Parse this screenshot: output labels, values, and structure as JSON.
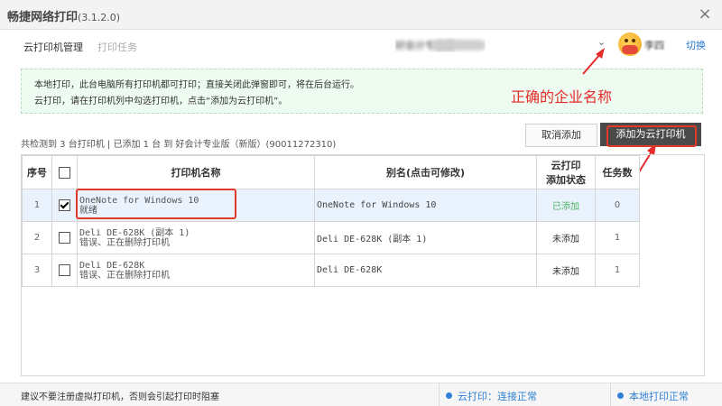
{
  "window": {
    "title": "畅捷网络打印",
    "version": "(3.1.2.0)",
    "close_glyph": "×"
  },
  "nav": {
    "manage": "云打印机管理",
    "tasks": "打印任务"
  },
  "header": {
    "company": "好会计专业版",
    "dropdown_glyph": "⌄",
    "user": "李四",
    "switch": "切换"
  },
  "notice": {
    "line1": "本地打印，此台电脑所有打印机都可打印；直接关闭此弹窗即可，将在后台运行。",
    "line2": "云打印，请在打印机列中勾选打印机，点击“添加为云打印机”。"
  },
  "annotation": {
    "label": "正确的企业名称",
    "accent": "#e52b2b"
  },
  "summary": "共检测到 3 台打印机 | 已添加 1 台 到 好会计专业版（新版）(90011272310)",
  "buttons": {
    "cancel": "取消添加",
    "add": "添加为云打印机"
  },
  "table": {
    "headers": {
      "index": "序号",
      "name": "打印机名称",
      "alias": "别名(点击可修改)",
      "status_line1": "云打印",
      "status_line2": "添加状态",
      "tasks": "任务数"
    },
    "rows": [
      {
        "index": "1",
        "checked": true,
        "name": "OneNote for Windows 10",
        "state": "就绪",
        "alias": "OneNote for Windows 10",
        "status": "已添加",
        "tasks": "0"
      },
      {
        "index": "2",
        "checked": false,
        "name": "Deli DE-628K (副本 1)",
        "state": "错误、正在删除打印机",
        "alias": "Deli DE-628K (副本 1)",
        "status": "未添加",
        "tasks": "1"
      },
      {
        "index": "3",
        "checked": false,
        "name": "Deli DE-628K",
        "state": "错误、正在删除打印机",
        "alias": "Deli DE-628K",
        "status": "未添加",
        "tasks": "1"
      }
    ]
  },
  "statusbar": {
    "tip": "建议不要注册虚拟打印机，否则会引起打印时阻塞",
    "cloud": "云打印：连接正常",
    "local": "本地打印正常"
  },
  "colors": {
    "accent_blue": "#2f80d6",
    "added_green": "#4bb561",
    "highlight_red": "#e23a2a",
    "dark_button": "#4a4a4a"
  }
}
